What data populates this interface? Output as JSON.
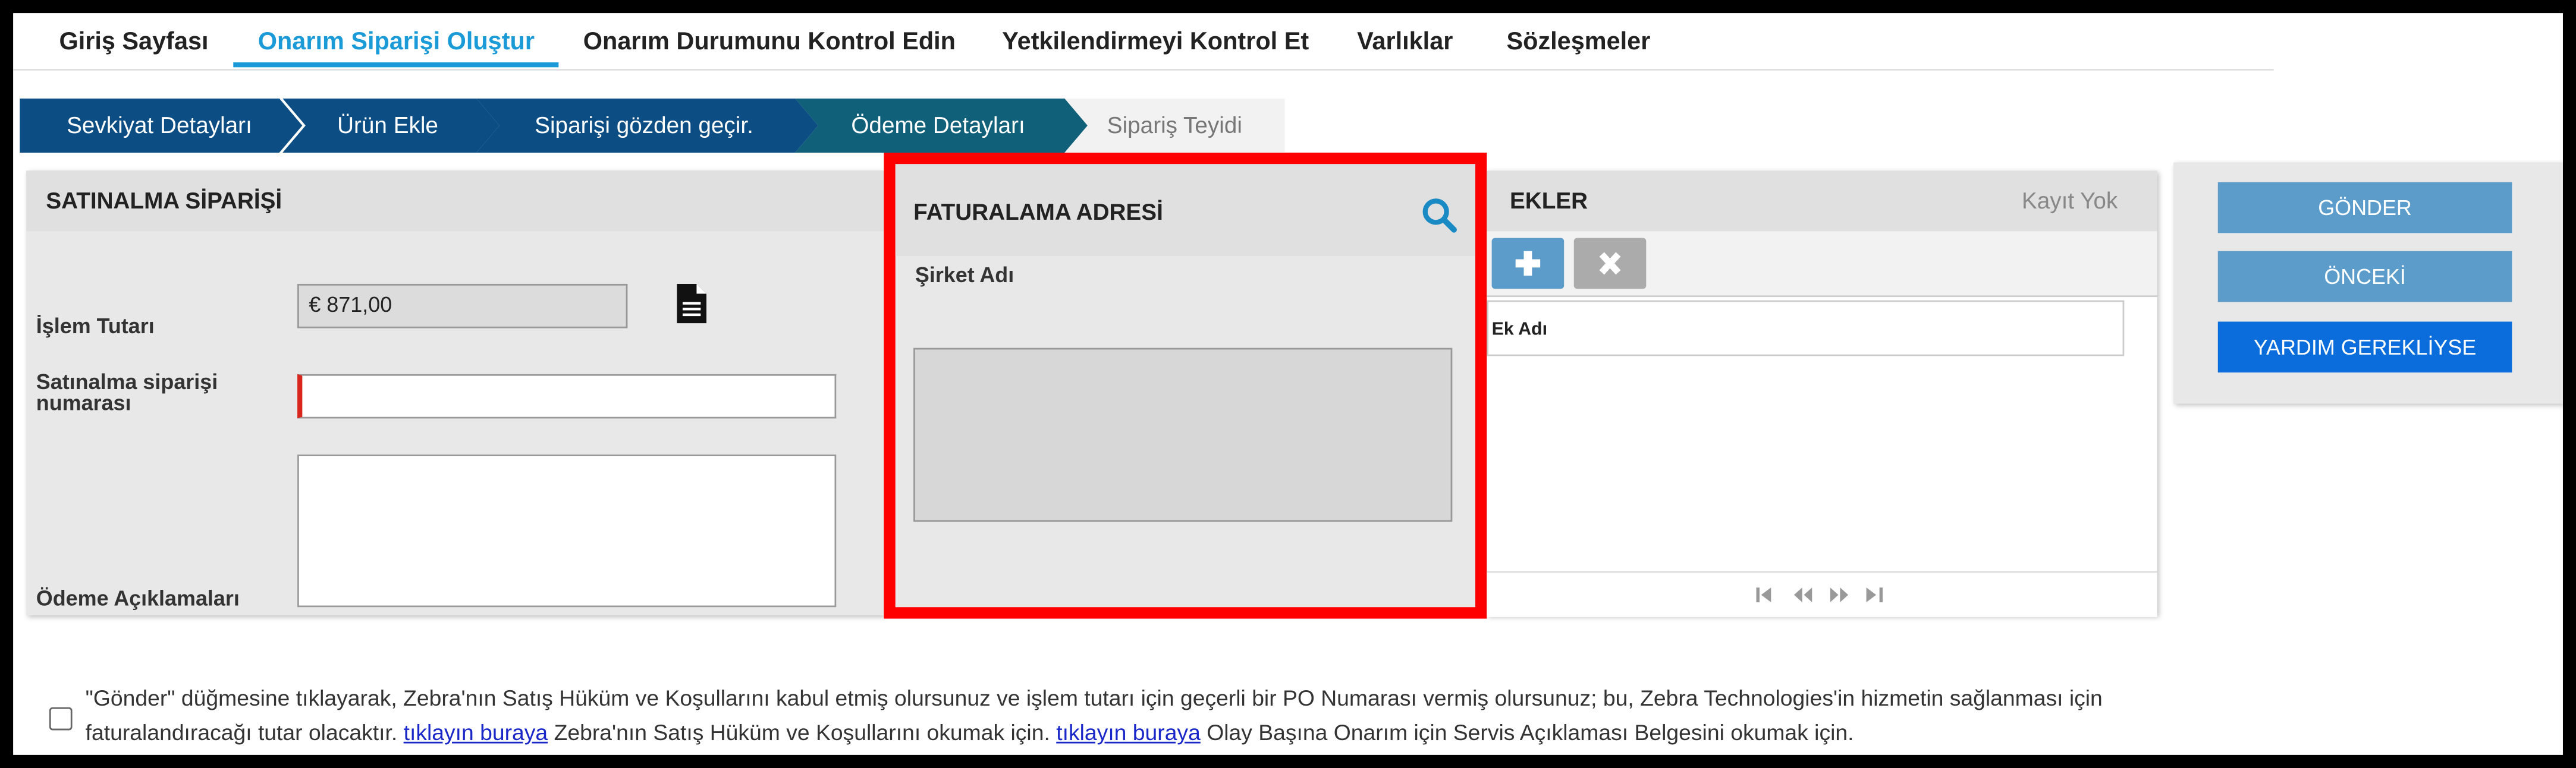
{
  "nav": {
    "items": [
      {
        "label": "Giriş Sayfası"
      },
      {
        "label": "Onarım Siparişi Oluştur"
      },
      {
        "label": "Onarım Durumunu Kontrol Edin"
      },
      {
        "label": "Yetkilendirmeyi Kontrol Et"
      },
      {
        "label": "Varlıklar"
      },
      {
        "label": "Sözleşmeler"
      }
    ],
    "active_index": 1
  },
  "steps": [
    {
      "label": "Sevkiyat Detayları",
      "state": "done"
    },
    {
      "label": "Ürün Ekle",
      "state": "done"
    },
    {
      "label": "Siparişi gözden geçir.",
      "state": "done"
    },
    {
      "label": "Ödeme Detayları",
      "state": "current"
    },
    {
      "label": "Sipariş Teyidi",
      "state": "pending"
    }
  ],
  "purchase_order": {
    "title": "SATINALMA SİPARİŞİ",
    "amount_label": "İşlem Tutarı",
    "amount_value": "€ 871,00",
    "po_number_label": "Satınalma siparişi numarası",
    "po_number_value": "",
    "payment_notes_label": "Ödeme Açıklamaları",
    "payment_notes_value": ""
  },
  "billing": {
    "title": "FATURALAMA ADRESİ",
    "company_label": "Şirket Adı",
    "address_value": ""
  },
  "attachments": {
    "title": "EKLER",
    "record_status": "Kayıt Yok",
    "column_header": "Ek Adı"
  },
  "actions": {
    "submit": "GÖNDER",
    "previous": "ÖNCEKİ",
    "help": "YARDIM GEREKLİYSE"
  },
  "terms": {
    "text_1": "\"Gönder\" düğmesine tıklayarak, Zebra'nın Satış Hüküm ve Koşullarını kabul etmiş olursunuz ve işlem tutarı için geçerli bir PO Numarası vermiş olursunuz; bu, Zebra Technologies'in hizmetin sağlanması için faturalandıracağı tutar olacaktır.",
    "link_1": "tıklayın buraya",
    "text_2": "Zebra'nın Satış Hüküm ve Koşullarını okumak için.",
    "link_2": "tıklayın buraya",
    "text_3": "Olay Başına Onarım için Servis Açıklaması Belgesini okumak için."
  },
  "colors": {
    "accent": "#1a9ad6",
    "step_done": "#0c4d84",
    "step_current": "#11607a",
    "step_pending": "#f2f2f2",
    "highlight_border": "#ff0000",
    "button_blue": "#5b9ccb",
    "button_help": "#0a6ddb"
  }
}
